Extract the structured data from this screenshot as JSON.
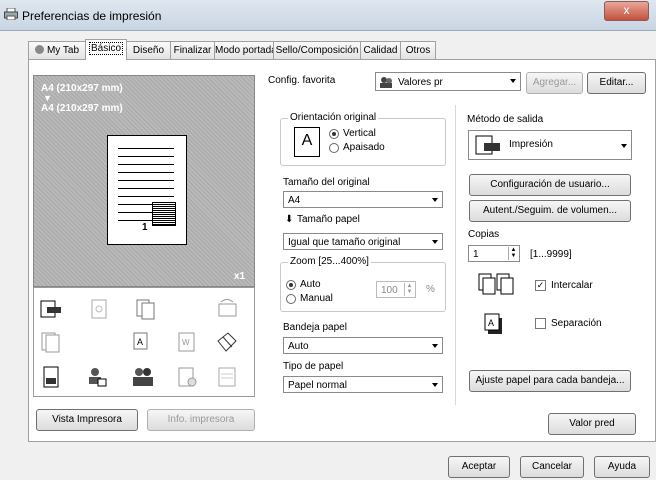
{
  "window": {
    "title": "Preferencias de impresión",
    "close": "x"
  },
  "tabs": [
    {
      "label": "My Tab"
    },
    {
      "label": "Básico"
    },
    {
      "label": "Diseño"
    },
    {
      "label": "Finalizar"
    },
    {
      "label": "Modo portada"
    },
    {
      "label": "Sello/Composición"
    },
    {
      "label": "Calidad"
    },
    {
      "label": "Otros"
    }
  ],
  "preview": {
    "size_line1": "A4 (210x297 mm)",
    "arrow": "▼",
    "size_line2": "A4 (210x297 mm)",
    "page_number": "1",
    "copies_badge": "x1"
  },
  "preview_buttons": {
    "vista": "Vista Impresora",
    "info": "Info. impresora"
  },
  "config": {
    "label": "Config. favorita",
    "value": "Valores pr",
    "agregar": "Agregar...",
    "editar": "Editar..."
  },
  "orientacion": {
    "label": "Orientación original",
    "vertical": "Vertical",
    "apaisado": "Apaisado",
    "selected": "Vertical"
  },
  "tamano_original": {
    "label": "Tamaño del original",
    "value": "A4"
  },
  "tamano_papel": {
    "label": "Tamaño papel",
    "value": "Igual que tamaño original"
  },
  "zoom": {
    "label": "Zoom [25...400%]",
    "auto": "Auto",
    "manual": "Manual",
    "value": "100",
    "unit": "%",
    "selected": "Auto"
  },
  "bandeja": {
    "label": "Bandeja papel",
    "value": "Auto"
  },
  "tipo": {
    "label": "Tipo de papel",
    "value": "Papel normal"
  },
  "salida": {
    "label": "Método de salida",
    "value": "Impresión"
  },
  "buttons": {
    "config_usuario": "Configuración de usuario...",
    "autent": "Autent./Seguim. de volumen...",
    "ajuste": "Ajuste papel para cada bandeja...",
    "valor_pred": "Valor pred",
    "aceptar": "Aceptar",
    "cancelar": "Cancelar",
    "ayuda": "Ayuda"
  },
  "copias": {
    "label": "Copias",
    "value": "1",
    "range": "[1...9999]"
  },
  "intercalar": {
    "label": "Intercalar",
    "checked": true
  },
  "separacion": {
    "label": "Separación",
    "checked": false
  }
}
